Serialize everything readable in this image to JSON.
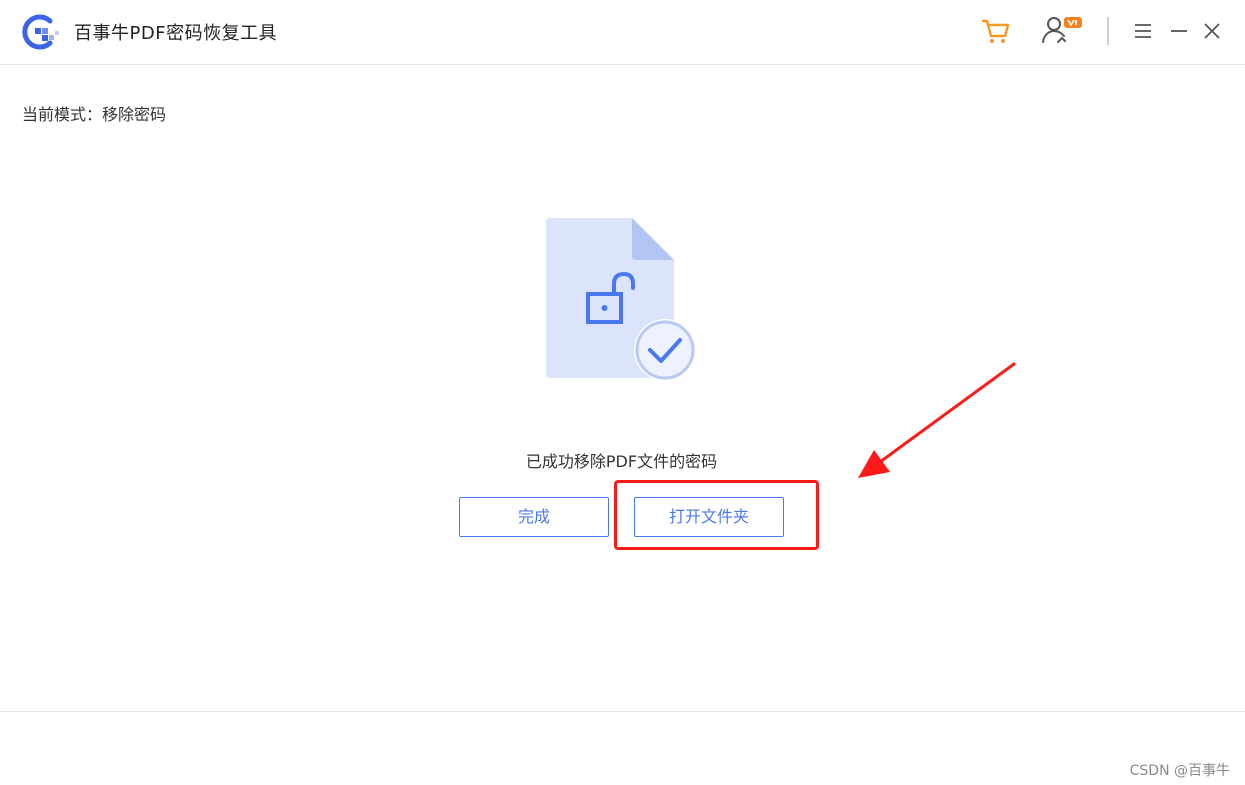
{
  "window": {
    "title": "百事牛PDF密码恢复工具",
    "icons": {
      "logo": "app-logo-icon",
      "cart": "shopping-cart-icon",
      "account": "user-vip-icon",
      "menu": "menu-icon",
      "minimize": "minimize-icon",
      "close": "close-icon"
    }
  },
  "mode": {
    "label": "当前模式：移除密码"
  },
  "result": {
    "illustration": "unlocked-document-check-icon",
    "message": "已成功移除PDF文件的密码"
  },
  "actions": {
    "done_label": "完成",
    "open_folder_label": "打开文件夹"
  },
  "annotation": {
    "color": "#ff1a1a"
  },
  "watermark": "CSDN @百事牛",
  "colors": {
    "accent": "#4a78f0",
    "cart": "#f59a23",
    "vip_badge": "#f5821f",
    "doc_fill": "#dbe4fb"
  }
}
